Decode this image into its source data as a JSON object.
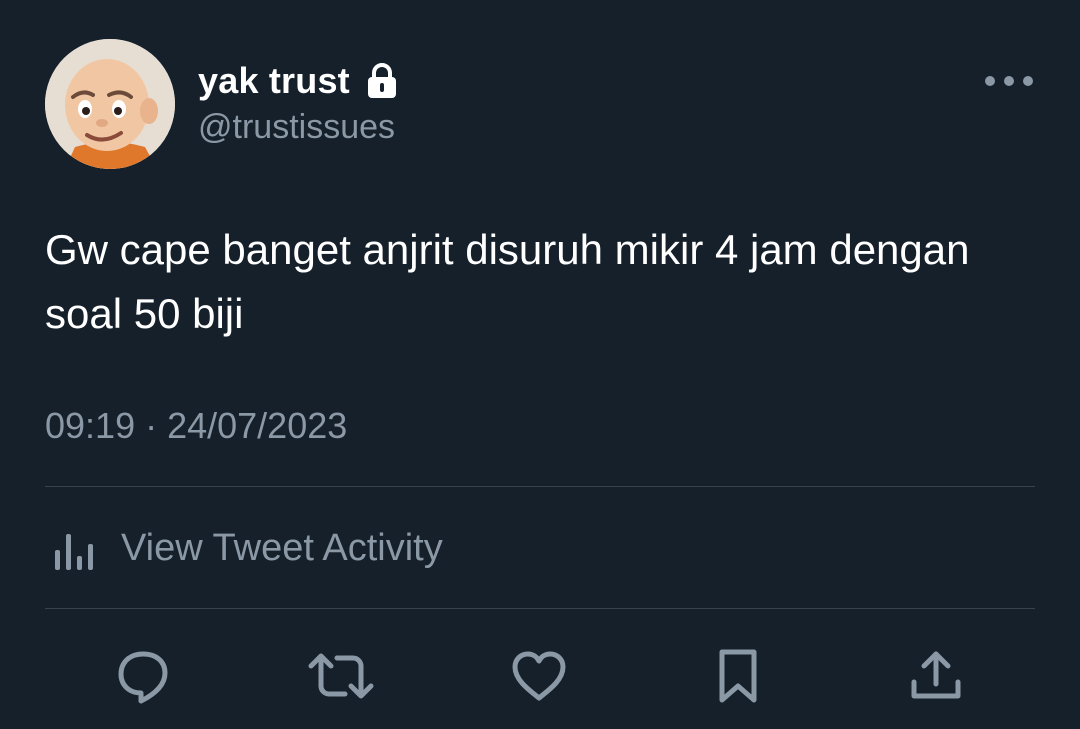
{
  "tweet": {
    "author": {
      "display_name": "yak trust",
      "handle": "@trustissues",
      "protected_icon": "lock-icon",
      "avatar": "cartoon-avatar"
    },
    "more_icon": "more-horizontal-icon",
    "text": "Gw cape banget anjrit disuruh mikir 4 jam dengan soal 50 biji",
    "timestamp": "09:19 · 24/07/2023",
    "activity_label": "View Tweet Activity",
    "activity_icon": "analytics-bars-icon",
    "actions": [
      {
        "name": "reply",
        "icon": "reply-icon"
      },
      {
        "name": "retweet",
        "icon": "retweet-icon"
      },
      {
        "name": "like",
        "icon": "heart-icon"
      },
      {
        "name": "bookmark",
        "icon": "bookmark-icon"
      },
      {
        "name": "share",
        "icon": "share-icon"
      }
    ]
  },
  "colors": {
    "background": "#15202b",
    "primary_text": "#ffffff",
    "secondary_text": "#8b98a5",
    "divider": "#38444d"
  }
}
